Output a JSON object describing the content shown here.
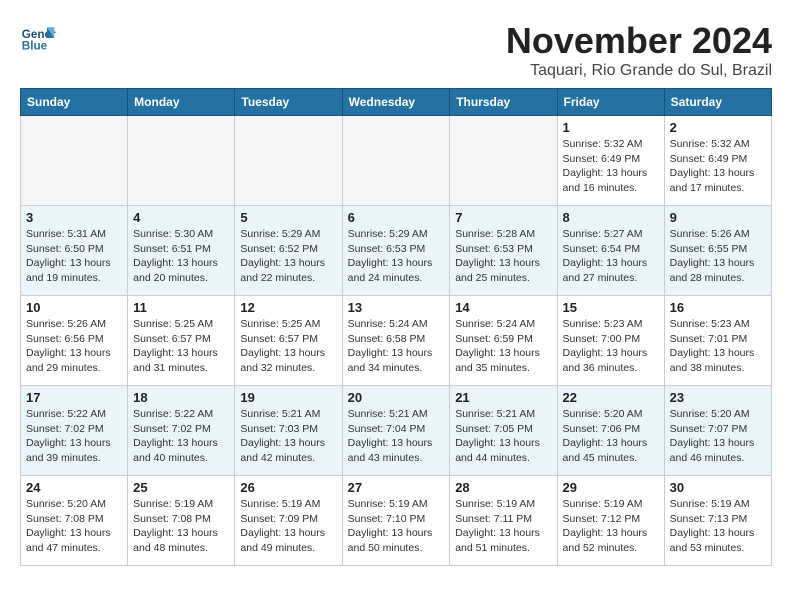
{
  "logo": {
    "text_general": "General",
    "text_blue": "Blue"
  },
  "header": {
    "month": "November 2024",
    "location": "Taquari, Rio Grande do Sul, Brazil"
  },
  "weekdays": [
    "Sunday",
    "Monday",
    "Tuesday",
    "Wednesday",
    "Thursday",
    "Friday",
    "Saturday"
  ],
  "weeks": [
    {
      "row_class": "row-white",
      "days": [
        {
          "date": "",
          "info": "",
          "empty": true
        },
        {
          "date": "",
          "info": "",
          "empty": true
        },
        {
          "date": "",
          "info": "",
          "empty": true
        },
        {
          "date": "",
          "info": "",
          "empty": true
        },
        {
          "date": "",
          "info": "",
          "empty": true
        },
        {
          "date": "1",
          "info": "Sunrise: 5:32 AM\nSunset: 6:49 PM\nDaylight: 13 hours\nand 16 minutes.",
          "empty": false
        },
        {
          "date": "2",
          "info": "Sunrise: 5:32 AM\nSunset: 6:49 PM\nDaylight: 13 hours\nand 17 minutes.",
          "empty": false
        }
      ]
    },
    {
      "row_class": "row-light",
      "days": [
        {
          "date": "3",
          "info": "Sunrise: 5:31 AM\nSunset: 6:50 PM\nDaylight: 13 hours\nand 19 minutes.",
          "empty": false
        },
        {
          "date": "4",
          "info": "Sunrise: 5:30 AM\nSunset: 6:51 PM\nDaylight: 13 hours\nand 20 minutes.",
          "empty": false
        },
        {
          "date": "5",
          "info": "Sunrise: 5:29 AM\nSunset: 6:52 PM\nDaylight: 13 hours\nand 22 minutes.",
          "empty": false
        },
        {
          "date": "6",
          "info": "Sunrise: 5:29 AM\nSunset: 6:53 PM\nDaylight: 13 hours\nand 24 minutes.",
          "empty": false
        },
        {
          "date": "7",
          "info": "Sunrise: 5:28 AM\nSunset: 6:53 PM\nDaylight: 13 hours\nand 25 minutes.",
          "empty": false
        },
        {
          "date": "8",
          "info": "Sunrise: 5:27 AM\nSunset: 6:54 PM\nDaylight: 13 hours\nand 27 minutes.",
          "empty": false
        },
        {
          "date": "9",
          "info": "Sunrise: 5:26 AM\nSunset: 6:55 PM\nDaylight: 13 hours\nand 28 minutes.",
          "empty": false
        }
      ]
    },
    {
      "row_class": "row-white",
      "days": [
        {
          "date": "10",
          "info": "Sunrise: 5:26 AM\nSunset: 6:56 PM\nDaylight: 13 hours\nand 29 minutes.",
          "empty": false
        },
        {
          "date": "11",
          "info": "Sunrise: 5:25 AM\nSunset: 6:57 PM\nDaylight: 13 hours\nand 31 minutes.",
          "empty": false
        },
        {
          "date": "12",
          "info": "Sunrise: 5:25 AM\nSunset: 6:57 PM\nDaylight: 13 hours\nand 32 minutes.",
          "empty": false
        },
        {
          "date": "13",
          "info": "Sunrise: 5:24 AM\nSunset: 6:58 PM\nDaylight: 13 hours\nand 34 minutes.",
          "empty": false
        },
        {
          "date": "14",
          "info": "Sunrise: 5:24 AM\nSunset: 6:59 PM\nDaylight: 13 hours\nand 35 minutes.",
          "empty": false
        },
        {
          "date": "15",
          "info": "Sunrise: 5:23 AM\nSunset: 7:00 PM\nDaylight: 13 hours\nand 36 minutes.",
          "empty": false
        },
        {
          "date": "16",
          "info": "Sunrise: 5:23 AM\nSunset: 7:01 PM\nDaylight: 13 hours\nand 38 minutes.",
          "empty": false
        }
      ]
    },
    {
      "row_class": "row-light",
      "days": [
        {
          "date": "17",
          "info": "Sunrise: 5:22 AM\nSunset: 7:02 PM\nDaylight: 13 hours\nand 39 minutes.",
          "empty": false
        },
        {
          "date": "18",
          "info": "Sunrise: 5:22 AM\nSunset: 7:02 PM\nDaylight: 13 hours\nand 40 minutes.",
          "empty": false
        },
        {
          "date": "19",
          "info": "Sunrise: 5:21 AM\nSunset: 7:03 PM\nDaylight: 13 hours\nand 42 minutes.",
          "empty": false
        },
        {
          "date": "20",
          "info": "Sunrise: 5:21 AM\nSunset: 7:04 PM\nDaylight: 13 hours\nand 43 minutes.",
          "empty": false
        },
        {
          "date": "21",
          "info": "Sunrise: 5:21 AM\nSunset: 7:05 PM\nDaylight: 13 hours\nand 44 minutes.",
          "empty": false
        },
        {
          "date": "22",
          "info": "Sunrise: 5:20 AM\nSunset: 7:06 PM\nDaylight: 13 hours\nand 45 minutes.",
          "empty": false
        },
        {
          "date": "23",
          "info": "Sunrise: 5:20 AM\nSunset: 7:07 PM\nDaylight: 13 hours\nand 46 minutes.",
          "empty": false
        }
      ]
    },
    {
      "row_class": "row-white",
      "days": [
        {
          "date": "24",
          "info": "Sunrise: 5:20 AM\nSunset: 7:08 PM\nDaylight: 13 hours\nand 47 minutes.",
          "empty": false
        },
        {
          "date": "25",
          "info": "Sunrise: 5:19 AM\nSunset: 7:08 PM\nDaylight: 13 hours\nand 48 minutes.",
          "empty": false
        },
        {
          "date": "26",
          "info": "Sunrise: 5:19 AM\nSunset: 7:09 PM\nDaylight: 13 hours\nand 49 minutes.",
          "empty": false
        },
        {
          "date": "27",
          "info": "Sunrise: 5:19 AM\nSunset: 7:10 PM\nDaylight: 13 hours\nand 50 minutes.",
          "empty": false
        },
        {
          "date": "28",
          "info": "Sunrise: 5:19 AM\nSunset: 7:11 PM\nDaylight: 13 hours\nand 51 minutes.",
          "empty": false
        },
        {
          "date": "29",
          "info": "Sunrise: 5:19 AM\nSunset: 7:12 PM\nDaylight: 13 hours\nand 52 minutes.",
          "empty": false
        },
        {
          "date": "30",
          "info": "Sunrise: 5:19 AM\nSunset: 7:13 PM\nDaylight: 13 hours\nand 53 minutes.",
          "empty": false
        }
      ]
    }
  ]
}
